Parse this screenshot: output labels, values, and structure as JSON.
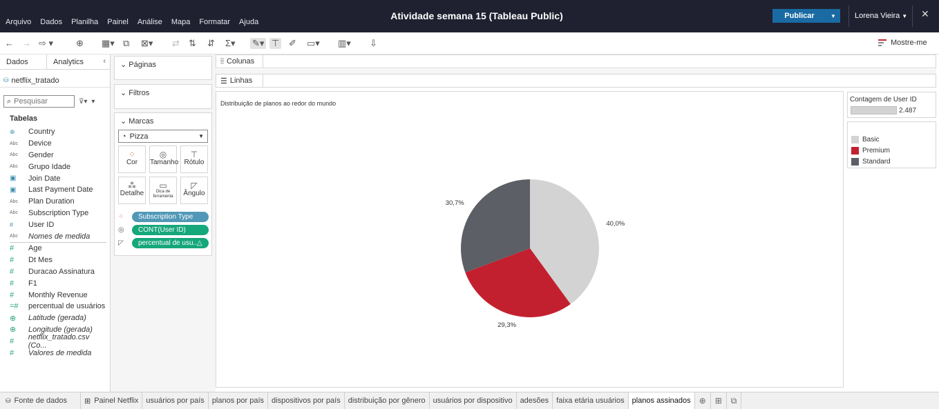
{
  "menu": [
    "Arquivo",
    "Dados",
    "Planilha",
    "Painel",
    "Análise",
    "Mapa",
    "Formatar",
    "Ajuda"
  ],
  "window_title": "Atividade semana 15 (Tableau Public)",
  "publish_label": "Publicar",
  "user_name": "Lorena Vieira",
  "show_me_label": "Mostre-me",
  "data_pane": {
    "tab_data": "Dados",
    "tab_analytics": "Analytics",
    "source": "netflix_tratado",
    "search_placeholder": "Pesquisar",
    "tables_header": "Tabelas",
    "dimensions": [
      {
        "type": "geo",
        "name": "Country"
      },
      {
        "type": "abc",
        "name": "Device"
      },
      {
        "type": "abc",
        "name": "Gender"
      },
      {
        "type": "abc",
        "name": "Grupo Idade"
      },
      {
        "type": "date",
        "name": "Join Date"
      },
      {
        "type": "date",
        "name": "Last Payment Date"
      },
      {
        "type": "abc",
        "name": "Plan Duration"
      },
      {
        "type": "abc",
        "name": "Subscription Type"
      },
      {
        "type": "num",
        "name": "User ID"
      },
      {
        "type": "abc",
        "name": "Nomes de medida",
        "italic": true
      }
    ],
    "measures": [
      {
        "type": "num",
        "name": "Age"
      },
      {
        "type": "num",
        "name": "Dt Mes"
      },
      {
        "type": "num",
        "name": "Duracao Assinatura"
      },
      {
        "type": "num",
        "name": "F1"
      },
      {
        "type": "num",
        "name": "Monthly Revenue"
      },
      {
        "type": "calc",
        "name": "percentual de usuários"
      },
      {
        "type": "globe",
        "name": "Latitude (gerada)",
        "italic": true
      },
      {
        "type": "globe",
        "name": "Longitude (gerada)",
        "italic": true
      },
      {
        "type": "num",
        "name": "netflix_tratado.csv (Co...",
        "italic": true
      },
      {
        "type": "num",
        "name": "Valores de medida",
        "italic": true
      }
    ]
  },
  "shelves": {
    "pages": "Páginas",
    "filters": "Filtros",
    "marks": "Marcas",
    "mark_type": "Pizza",
    "mark_buttons": [
      "Cor",
      "Tamanho",
      "Rótulo",
      "Detalhe",
      "Dica de ferramenta",
      "Ângulo"
    ],
    "pills": [
      "Subscription Type",
      "CONT(User ID)",
      "percentual de usu..△"
    ],
    "columns": "Colunas",
    "rows": "Linhas"
  },
  "view_title": "Distribuição de planos ao redor do mundo",
  "size_legend": {
    "title": "Contagem de User ID",
    "value": "2.487"
  },
  "colors": {
    "Basic": "#d3d3d3",
    "Premium": "#c3202f",
    "Standard": "#5c5f66"
  },
  "chart_data": {
    "type": "pie",
    "title": "Distribuição de planos ao redor do mundo",
    "slices": [
      {
        "name": "Basic",
        "value": 40.0,
        "label": "40,0%",
        "color": "#d3d3d3"
      },
      {
        "name": "Premium",
        "value": 29.3,
        "label": "29,3%",
        "color": "#c3202f"
      },
      {
        "name": "Standard",
        "value": 30.7,
        "label": "30,7%",
        "color": "#5c5f66"
      }
    ],
    "legend": [
      "Basic",
      "Premium",
      "Standard"
    ]
  },
  "bottom_tabs": [
    "Fonte de dados",
    "Painel Netflix",
    "usuários por país",
    "planos por país",
    "dispositivos por país",
    "distribuição por gênero",
    "usuários por dispositivo",
    "adesões",
    "faixa etária usuários",
    "planos assinados"
  ],
  "active_tab": "planos assinados"
}
